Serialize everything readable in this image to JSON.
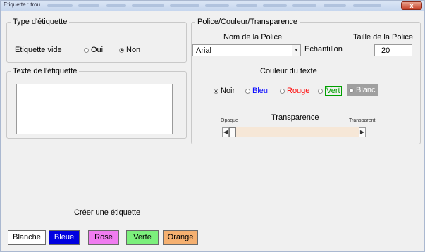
{
  "window": {
    "title": "Etiquette : trou",
    "close_label": "x"
  },
  "type_group": {
    "legend": "Type d'étiquette",
    "vide_label": "Etiquette vide",
    "oui_label": "Oui",
    "non_label": "Non",
    "selected": "Non"
  },
  "texte_group": {
    "legend": "Texte de l'étiquette",
    "value": ""
  },
  "police_group": {
    "legend": "Police/Couleur/Transparence",
    "nom_label": "Nom de la Police",
    "taille_label": "Taille de la Police",
    "font_value": "Arial",
    "echantillon_label": "Echantillon",
    "size_value": "20",
    "couleur_label": "Couleur du texte",
    "colors": {
      "noir": "Noir",
      "bleu": "Bleu",
      "rouge": "Rouge",
      "vert": "Vert",
      "blanc": "Blanc"
    },
    "selected_color": "Noir",
    "transparence_label": "Transparence",
    "opaque_label": "Opaque",
    "transparent_label": "Transparent",
    "transparence_value": 0
  },
  "create": {
    "label": "Créer une étiquette",
    "buttons": {
      "blanche": "Blanche",
      "bleue": "Bleue",
      "rose": "Rose",
      "verte": "Verte",
      "orange": "Orange"
    }
  },
  "colors": {
    "bleu": "#0000ff",
    "rouge": "#ff0000",
    "vert": "#00a000",
    "blanc_bg": "#a0a0a0",
    "btn_blanche": "#ffffff",
    "btn_bleue": "#0000e0",
    "btn_rose": "#f07cf0",
    "btn_verte": "#7cf07c",
    "btn_orange": "#f5b070",
    "scroll_track": "#f6e7d7"
  }
}
